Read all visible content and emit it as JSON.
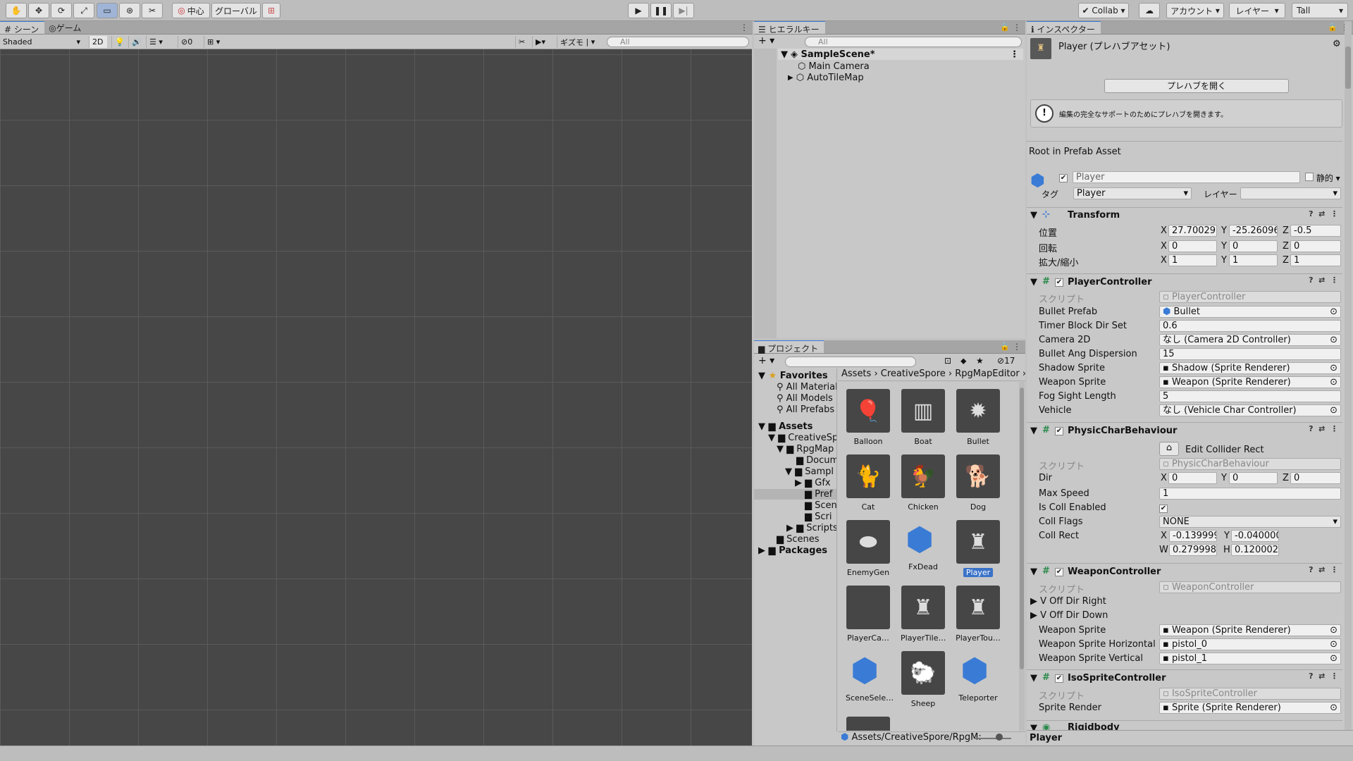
{
  "toolbar": {
    "pivot": "中心",
    "space": "グローバル",
    "collab": "Collab",
    "account": "アカウント",
    "layers": "レイヤー",
    "layout": "Tall"
  },
  "scene_panel": {
    "tab_scene": "シーン",
    "tab_game": "ゲーム",
    "shading": "Shaded",
    "mode_2d": "2D",
    "hidden_count": "0",
    "gizmos": "ギズモ",
    "search_placeholder": "All"
  },
  "hierarchy": {
    "title": "ヒエラルキー",
    "search_placeholder": "All",
    "scene": "SampleScene*",
    "items": [
      "Main Camera",
      "AutoTileMap"
    ]
  },
  "project": {
    "title": "プロジェクト",
    "badge_count": "17",
    "breadcrumb": [
      "Assets",
      "CreativeSpore",
      "RpgMapEditor"
    ],
    "favorites": {
      "label": "Favorites",
      "items": [
        "All Material",
        "All Models",
        "All Prefabs"
      ]
    },
    "tree": {
      "assets": "Assets",
      "creative": "CreativeSp",
      "rpgmap": "RpgMap",
      "docu": "Docum",
      "sampl": "Sampl",
      "gfx": "Gfx",
      "pref": "Pref",
      "scen": "Scen",
      "scri": "Scri",
      "scripts": "Scripts",
      "scenes": "Scenes",
      "packages": "Packages"
    },
    "assets": [
      {
        "name": "Balloon",
        "icon": "balloon-icon",
        "glyph": "🎈"
      },
      {
        "name": "Boat",
        "icon": "boat-icon",
        "glyph": "▥"
      },
      {
        "name": "Bullet",
        "icon": "bullet-icon",
        "glyph": "✹"
      },
      {
        "name": "Cat",
        "icon": "cat-icon",
        "glyph": "🐈"
      },
      {
        "name": "Chicken",
        "icon": "chicken-icon",
        "glyph": "🐓"
      },
      {
        "name": "Dog",
        "icon": "dog-icon",
        "glyph": "🐕"
      },
      {
        "name": "EnemyGen",
        "icon": "shadow-icon",
        "glyph": "⬬"
      },
      {
        "name": "FxDead",
        "icon": "prefab-cube-icon",
        "glyph": "cube"
      },
      {
        "name": "Player",
        "icon": "player-sprite-icon",
        "glyph": "♜",
        "selected": true
      },
      {
        "name": "PlayerCa…",
        "icon": "empty-thumb-icon",
        "glyph": ""
      },
      {
        "name": "PlayerTile…",
        "icon": "player-sprite-icon",
        "glyph": "♜"
      },
      {
        "name": "PlayerTou…",
        "icon": "player-sprite-icon",
        "glyph": "♜"
      },
      {
        "name": "SceneSele…",
        "icon": "prefab-cube-icon",
        "glyph": "cube"
      },
      {
        "name": "Sheep",
        "icon": "sheep-icon",
        "glyph": "🐑"
      },
      {
        "name": "Teleporter",
        "icon": "prefab-cube-icon",
        "glyph": "cube"
      }
    ],
    "footer_path": "Assets/CreativeSpore/RpgM:"
  },
  "inspector": {
    "title": "インスペクター",
    "header_name": "Player (プレハブアセット)",
    "open_prefab": "プレハブを開く",
    "help": "編集の完全なサポートのためにプレハブを開きます。",
    "root_label": "Root in Prefab Asset",
    "object_name": "Player",
    "static_label": "静的",
    "tag_label": "タグ",
    "tag_value": "Player",
    "layer_label": "レイヤー",
    "layer_value": "",
    "transform": {
      "title": "Transform",
      "position": {
        "label": "位置",
        "x": "27.70029",
        "y": "-25.26096",
        "z": "-0.5"
      },
      "rotation": {
        "label": "回転",
        "x": "0",
        "y": "0",
        "z": "0"
      },
      "scale": {
        "label": "拡大/縮小",
        "x": "1",
        "y": "1",
        "z": "1"
      }
    },
    "player_controller": {
      "title": "PlayerController",
      "script_label": "スクリプト",
      "script": "PlayerController",
      "fields": [
        {
          "label": "Bullet Prefab",
          "value": "Bullet"
        },
        {
          "label": "Timer Block Dir Set",
          "value": "0.6"
        },
        {
          "label": "Camera 2D",
          "value": "なし (Camera 2D Controller)"
        },
        {
          "label": "Bullet Ang Dispersion",
          "value": "15"
        },
        {
          "label": "Shadow Sprite",
          "value": "Shadow (Sprite Renderer)"
        },
        {
          "label": "Weapon Sprite",
          "value": "Weapon (Sprite Renderer)"
        },
        {
          "label": "Fog Sight Length",
          "value": "5"
        },
        {
          "label": "Vehicle",
          "value": "なし (Vehicle Char Controller)"
        }
      ]
    },
    "physic": {
      "title": "PhysicCharBehaviour",
      "edit_collider": "Edit Collider Rect",
      "script_label": "スクリプト",
      "script": "PhysicCharBehaviour",
      "dir": {
        "label": "Dir",
        "x": "0",
        "y": "0",
        "z": "0"
      },
      "max_speed": {
        "label": "Max Speed",
        "value": "1"
      },
      "is_coll": {
        "label": "Is Coll Enabled"
      },
      "coll_flags": {
        "label": "Coll Flags",
        "value": "NONE"
      },
      "coll_rect": {
        "label": "Coll Rect",
        "x": "-0.139999",
        "y": "-0.040000",
        "w": "0.279998",
        "h": "0.120002"
      }
    },
    "weapon": {
      "title": "WeaponController",
      "script_label": "スクリプト",
      "script": "WeaponController",
      "v_right": "V Off Dir Right",
      "v_down": "V Off Dir Down",
      "fields": [
        {
          "label": "Weapon Sprite",
          "value": "Weapon (Sprite Renderer)"
        },
        {
          "label": "Weapon Sprite Horizontal",
          "value": "pistol_0"
        },
        {
          "label": "Weapon Sprite Vertical",
          "value": "pistol_1"
        }
      ]
    },
    "iso": {
      "title": "IsoSpriteController",
      "script_label": "スクリプト",
      "script": "IsoSpriteController",
      "sprite_render": {
        "label": "Sprite Render",
        "value": "Sprite (Sprite Renderer)"
      }
    },
    "rigidbody": {
      "title": "Rigidbody"
    },
    "footer_label": "Player"
  }
}
